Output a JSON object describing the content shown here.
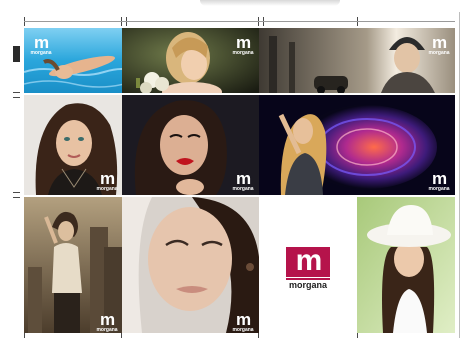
{
  "gallery": {
    "brand_mark": "m",
    "brand_name": "morgana",
    "brand_color": "#b5134b",
    "tiles": [
      {
        "name": "photo-tile-pool",
        "subject": "woman floating in pool water"
      },
      {
        "name": "photo-tile-bride-flowers",
        "subject": "woman with flower bouquet"
      },
      {
        "name": "photo-tile-beanie-street",
        "subject": "woman in beanie on street"
      },
      {
        "name": "photo-tile-brunette-portrait",
        "subject": "brunette portrait"
      },
      {
        "name": "photo-tile-red-lips",
        "subject": "woman with red lips"
      },
      {
        "name": "photo-tile-blonde-lights",
        "subject": "blonde woman with purple light effect"
      },
      {
        "name": "photo-tile-city-ruins",
        "subject": "woman in sepia city scene"
      },
      {
        "name": "photo-tile-closeup-face",
        "subject": "close-up face portrait"
      },
      {
        "name": "brand-logo-tile",
        "subject": "morgana logo"
      },
      {
        "name": "photo-tile-white-hat",
        "subject": "woman in white sun hat"
      }
    ]
  }
}
